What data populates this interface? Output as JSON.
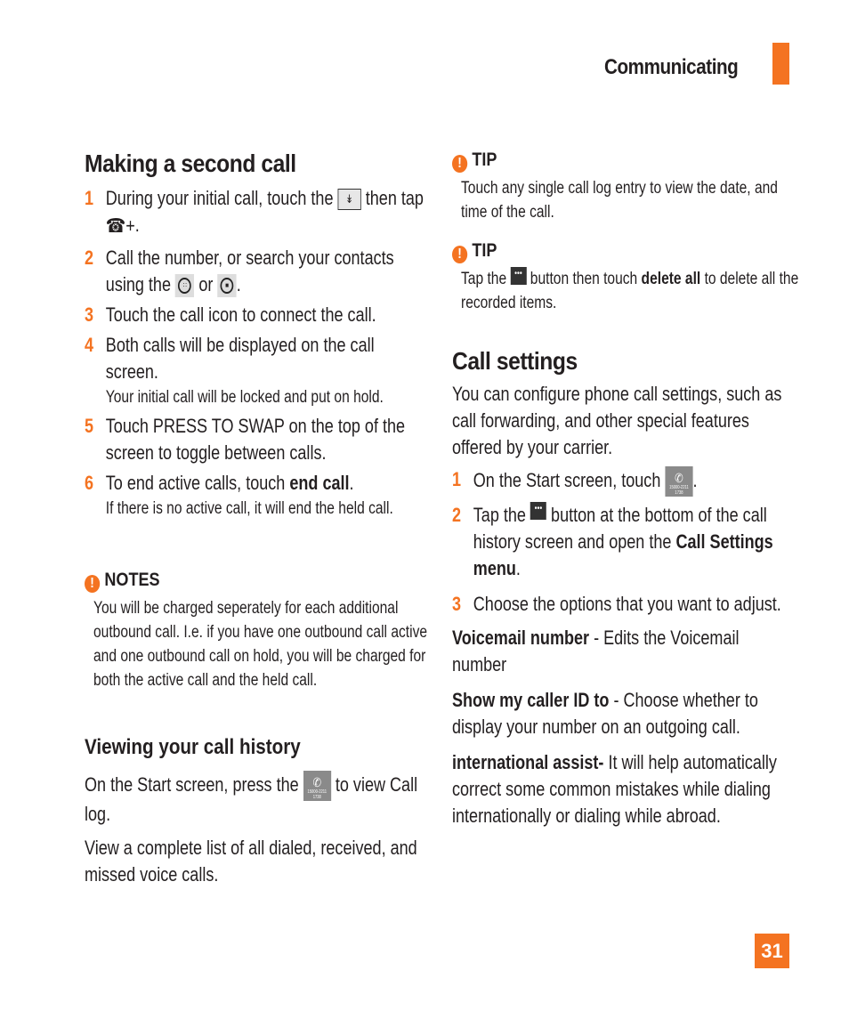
{
  "header": {
    "section": "Communicating",
    "accent_color": "#f47321"
  },
  "page_number": "31",
  "left": {
    "title": "Making a second call",
    "steps": [
      {
        "num": "1",
        "t1": "During your initial call, touch the",
        "t2": "then tap",
        "t3": "."
      },
      {
        "num": "2",
        "t1": "Call the number, or search your contacts using the",
        "t2": "or",
        "t3": "."
      },
      {
        "num": "3",
        "t1": "Touch the call icon to connect the call."
      },
      {
        "num": "4",
        "t1": "Both calls will be displayed on the call screen.",
        "note": "Your initial call will be locked and put on hold."
      },
      {
        "num": "5",
        "t1": "Touch PRESS TO SWAP on the top of the screen  to toggle between calls."
      },
      {
        "num": "6",
        "t1": "To end active calls, touch",
        "bold": "end call",
        "t3": ".",
        "note": "If there is no active call, it will end the held call."
      }
    ],
    "notes": {
      "label": "NOTES",
      "text": "You will be charged seperately for each additional outbound call. I.e. if you have one outbound call active and one outbound call on hold, you will be charged for both the active call and the held call."
    },
    "history": {
      "title": "Viewing your call history",
      "p1a": "On the Start screen, press the",
      "p1b": "to view Call log.",
      "p2": "View a complete list of all dialed, received, and missed voice calls."
    }
  },
  "right": {
    "tip1": {
      "label": "TIP",
      "text": "Touch any single call log entry to view the date, and time of the call."
    },
    "tip2": {
      "label": "TIP",
      "a": "Tap the",
      "b": "button then touch",
      "bold": "delete all",
      "c": "to delete all the recorded items."
    },
    "settings": {
      "title": "Call settings",
      "intro": "You can configure phone call settings, such as call forwarding, and other special features offered by your carrier.",
      "steps": [
        {
          "num": "1",
          "a": "On the Start screen, touch",
          "b": "."
        },
        {
          "num": "2",
          "a": "Tap the",
          "b": "button at the bottom of the call history screen and open the",
          "bold": "Call Settings menu",
          "c": "."
        },
        {
          "num": "3",
          "a": "Choose the options that you want to adjust."
        }
      ],
      "options": [
        {
          "name": "Voicemail number",
          "desc": " - Edits the Voicemail number"
        },
        {
          "name": "Show my caller ID to",
          "desc": " - Choose whether to display your number on an outgoing call."
        },
        {
          "name": "international assist-",
          "desc": " It will help automatically correct some common mistakes while dialing internationally or dialing while abroad."
        }
      ]
    }
  },
  "icons": {
    "tile_caption": "15000-2211 1738"
  }
}
